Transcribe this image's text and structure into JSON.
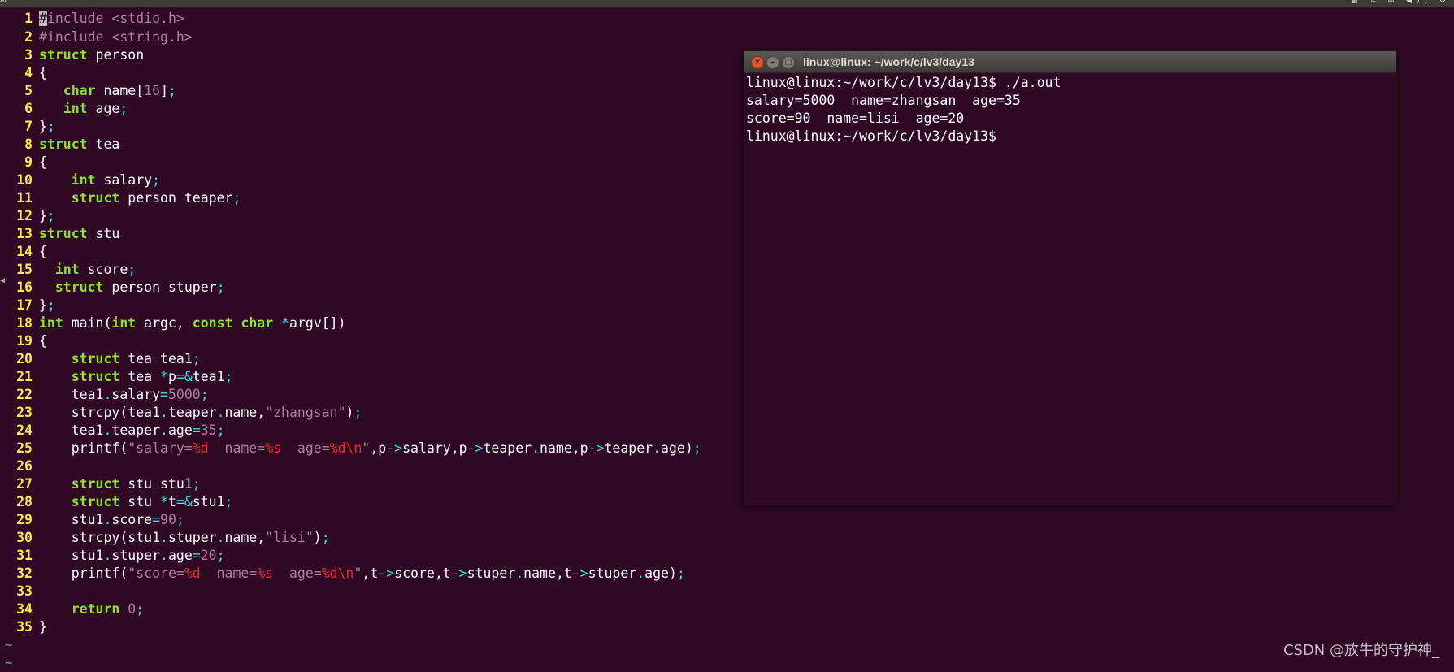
{
  "topbar": {
    "app_title": "al",
    "indicators": "▦ ⇅ ✉ ◀)) ⚙"
  },
  "editor": {
    "lines": [
      {
        "n": "1",
        "tokens": [
          [
            "cursor",
            "#"
          ],
          [
            "pre",
            "include <stdio.h>"
          ]
        ]
      },
      {
        "n": "2",
        "tokens": [
          [
            "pre",
            "#include <string.h>"
          ]
        ]
      },
      {
        "n": "3",
        "tokens": [
          [
            "kw",
            "struct"
          ],
          [
            "plain",
            " person"
          ]
        ]
      },
      {
        "n": "4",
        "tokens": [
          [
            "plain",
            "{"
          ]
        ]
      },
      {
        "n": "5",
        "tokens": [
          [
            "plain",
            "   "
          ],
          [
            "kw",
            "char"
          ],
          [
            "plain",
            " name["
          ],
          [
            "num",
            "16"
          ],
          [
            "plain",
            "]"
          ],
          [
            "op",
            ";"
          ]
        ]
      },
      {
        "n": "6",
        "tokens": [
          [
            "plain",
            "   "
          ],
          [
            "kw",
            "int"
          ],
          [
            "plain",
            " age"
          ],
          [
            "op",
            ";"
          ]
        ]
      },
      {
        "n": "7",
        "tokens": [
          [
            "plain",
            "}"
          ],
          [
            "op",
            ";"
          ]
        ]
      },
      {
        "n": "8",
        "tokens": [
          [
            "kw",
            "struct"
          ],
          [
            "plain",
            " tea"
          ]
        ]
      },
      {
        "n": "9",
        "tokens": [
          [
            "plain",
            "{"
          ]
        ]
      },
      {
        "n": "10",
        "tokens": [
          [
            "plain",
            "    "
          ],
          [
            "kw",
            "int"
          ],
          [
            "plain",
            " salary"
          ],
          [
            "op",
            ";"
          ]
        ]
      },
      {
        "n": "11",
        "tokens": [
          [
            "plain",
            "    "
          ],
          [
            "kw",
            "struct"
          ],
          [
            "plain",
            " person teaper"
          ],
          [
            "op",
            ";"
          ]
        ]
      },
      {
        "n": "12",
        "tokens": [
          [
            "plain",
            "}"
          ],
          [
            "op",
            ";"
          ]
        ]
      },
      {
        "n": "13",
        "tokens": [
          [
            "kw",
            "struct"
          ],
          [
            "plain",
            " stu"
          ]
        ]
      },
      {
        "n": "14",
        "tokens": [
          [
            "plain",
            "{"
          ]
        ]
      },
      {
        "n": "15",
        "tokens": [
          [
            "plain",
            "  "
          ],
          [
            "kw",
            "int"
          ],
          [
            "plain",
            " score"
          ],
          [
            "op",
            ";"
          ]
        ]
      },
      {
        "n": "16",
        "tokens": [
          [
            "plain",
            "  "
          ],
          [
            "kw",
            "struct"
          ],
          [
            "plain",
            " person stuper"
          ],
          [
            "op",
            ";"
          ]
        ]
      },
      {
        "n": "17",
        "tokens": [
          [
            "plain",
            "}"
          ],
          [
            "op",
            ";"
          ]
        ]
      },
      {
        "n": "18",
        "tokens": [
          [
            "kw",
            "int"
          ],
          [
            "plain",
            " main("
          ],
          [
            "kw",
            "int"
          ],
          [
            "plain",
            " argc, "
          ],
          [
            "kw",
            "const"
          ],
          [
            "plain",
            " "
          ],
          [
            "kw",
            "char"
          ],
          [
            "plain",
            " "
          ],
          [
            "op",
            "*"
          ],
          [
            "plain",
            "argv[])"
          ]
        ]
      },
      {
        "n": "19",
        "tokens": [
          [
            "plain",
            "{"
          ]
        ]
      },
      {
        "n": "20",
        "tokens": [
          [
            "plain",
            "    "
          ],
          [
            "kw",
            "struct"
          ],
          [
            "plain",
            " tea tea1"
          ],
          [
            "op",
            ";"
          ]
        ]
      },
      {
        "n": "21",
        "tokens": [
          [
            "plain",
            "    "
          ],
          [
            "kw",
            "struct"
          ],
          [
            "plain",
            " tea "
          ],
          [
            "op",
            "*"
          ],
          [
            "plain",
            "p"
          ],
          [
            "op",
            "=&"
          ],
          [
            "plain",
            "tea1"
          ],
          [
            "op",
            ";"
          ]
        ]
      },
      {
        "n": "22",
        "tokens": [
          [
            "plain",
            "    tea1"
          ],
          [
            "op",
            "."
          ],
          [
            "plain",
            "salary"
          ],
          [
            "op",
            "="
          ],
          [
            "num",
            "5000"
          ],
          [
            "op",
            ";"
          ]
        ]
      },
      {
        "n": "23",
        "tokens": [
          [
            "plain",
            "    strcpy(tea1"
          ],
          [
            "op",
            "."
          ],
          [
            "plain",
            "teaper"
          ],
          [
            "op",
            "."
          ],
          [
            "plain",
            "name,"
          ],
          [
            "str",
            "\"zhangsan\""
          ],
          [
            "plain",
            ")"
          ],
          [
            "op",
            ";"
          ]
        ]
      },
      {
        "n": "24",
        "tokens": [
          [
            "plain",
            "    tea1"
          ],
          [
            "op",
            "."
          ],
          [
            "plain",
            "teaper"
          ],
          [
            "op",
            "."
          ],
          [
            "plain",
            "age"
          ],
          [
            "op",
            "="
          ],
          [
            "num",
            "35"
          ],
          [
            "op",
            ";"
          ]
        ]
      },
      {
        "n": "25",
        "tokens": [
          [
            "plain",
            "    printf("
          ],
          [
            "str",
            "\"salary="
          ],
          [
            "fmt",
            "%d"
          ],
          [
            "str",
            "  name="
          ],
          [
            "fmt",
            "%s"
          ],
          [
            "str",
            "  age="
          ],
          [
            "fmt",
            "%d\\n"
          ],
          [
            "str",
            "\""
          ],
          [
            "plain",
            ",p"
          ],
          [
            "op",
            "->"
          ],
          [
            "plain",
            "salary,p"
          ],
          [
            "op",
            "->"
          ],
          [
            "plain",
            "teaper"
          ],
          [
            "op",
            "."
          ],
          [
            "plain",
            "name,p"
          ],
          [
            "op",
            "->"
          ],
          [
            "plain",
            "teaper"
          ],
          [
            "op",
            "."
          ],
          [
            "plain",
            "age)"
          ],
          [
            "op",
            ";"
          ]
        ]
      },
      {
        "n": "26",
        "tokens": []
      },
      {
        "n": "27",
        "tokens": [
          [
            "plain",
            "    "
          ],
          [
            "kw",
            "struct"
          ],
          [
            "plain",
            " stu stu1"
          ],
          [
            "op",
            ";"
          ]
        ]
      },
      {
        "n": "28",
        "tokens": [
          [
            "plain",
            "    "
          ],
          [
            "kw",
            "struct"
          ],
          [
            "plain",
            " stu "
          ],
          [
            "op",
            "*"
          ],
          [
            "plain",
            "t"
          ],
          [
            "op",
            "=&"
          ],
          [
            "plain",
            "stu1"
          ],
          [
            "op",
            ";"
          ]
        ]
      },
      {
        "n": "29",
        "tokens": [
          [
            "plain",
            "    stu1"
          ],
          [
            "op",
            "."
          ],
          [
            "plain",
            "score"
          ],
          [
            "op",
            "="
          ],
          [
            "num",
            "90"
          ],
          [
            "op",
            ";"
          ]
        ]
      },
      {
        "n": "30",
        "tokens": [
          [
            "plain",
            "    strcpy(stu1"
          ],
          [
            "op",
            "."
          ],
          [
            "plain",
            "stuper"
          ],
          [
            "op",
            "."
          ],
          [
            "plain",
            "name,"
          ],
          [
            "str",
            "\"lisi\""
          ],
          [
            "plain",
            ")"
          ],
          [
            "op",
            ";"
          ]
        ]
      },
      {
        "n": "31",
        "tokens": [
          [
            "plain",
            "    stu1"
          ],
          [
            "op",
            "."
          ],
          [
            "plain",
            "stuper"
          ],
          [
            "op",
            "."
          ],
          [
            "plain",
            "age"
          ],
          [
            "op",
            "="
          ],
          [
            "num",
            "20"
          ],
          [
            "op",
            ";"
          ]
        ]
      },
      {
        "n": "32",
        "tokens": [
          [
            "plain",
            "    printf("
          ],
          [
            "str",
            "\"score="
          ],
          [
            "fmt",
            "%d"
          ],
          [
            "str",
            "  name="
          ],
          [
            "fmt",
            "%s"
          ],
          [
            "str",
            "  age="
          ],
          [
            "fmt",
            "%d\\n"
          ],
          [
            "str",
            "\""
          ],
          [
            "plain",
            ",t"
          ],
          [
            "op",
            "->"
          ],
          [
            "plain",
            "score,t"
          ],
          [
            "op",
            "->"
          ],
          [
            "plain",
            "stuper"
          ],
          [
            "op",
            "."
          ],
          [
            "plain",
            "name,t"
          ],
          [
            "op",
            "->"
          ],
          [
            "plain",
            "stuper"
          ],
          [
            "op",
            "."
          ],
          [
            "plain",
            "age)"
          ],
          [
            "op",
            ";"
          ]
        ]
      },
      {
        "n": "33",
        "tokens": []
      },
      {
        "n": "34",
        "tokens": [
          [
            "plain",
            "    "
          ],
          [
            "kw",
            "return"
          ],
          [
            "plain",
            " "
          ],
          [
            "num",
            "0"
          ],
          [
            "op",
            ";"
          ]
        ]
      },
      {
        "n": "35",
        "tokens": [
          [
            "plain",
            "}"
          ]
        ]
      }
    ],
    "tildes": [
      "~",
      "~"
    ]
  },
  "terminal": {
    "title": "linux@linux: ~/work/c/lv3/day13",
    "buttons": {
      "close": "×",
      "minimize": "–",
      "maximize": "□"
    },
    "lines": [
      "linux@linux:~/work/c/lv3/day13$ ./a.out",
      "salary=5000  name=zhangsan  age=35",
      "score=90  name=lisi  age=20",
      "linux@linux:~/work/c/lv3/day13$ "
    ]
  },
  "watermark": "CSDN @放牛的守护神_"
}
